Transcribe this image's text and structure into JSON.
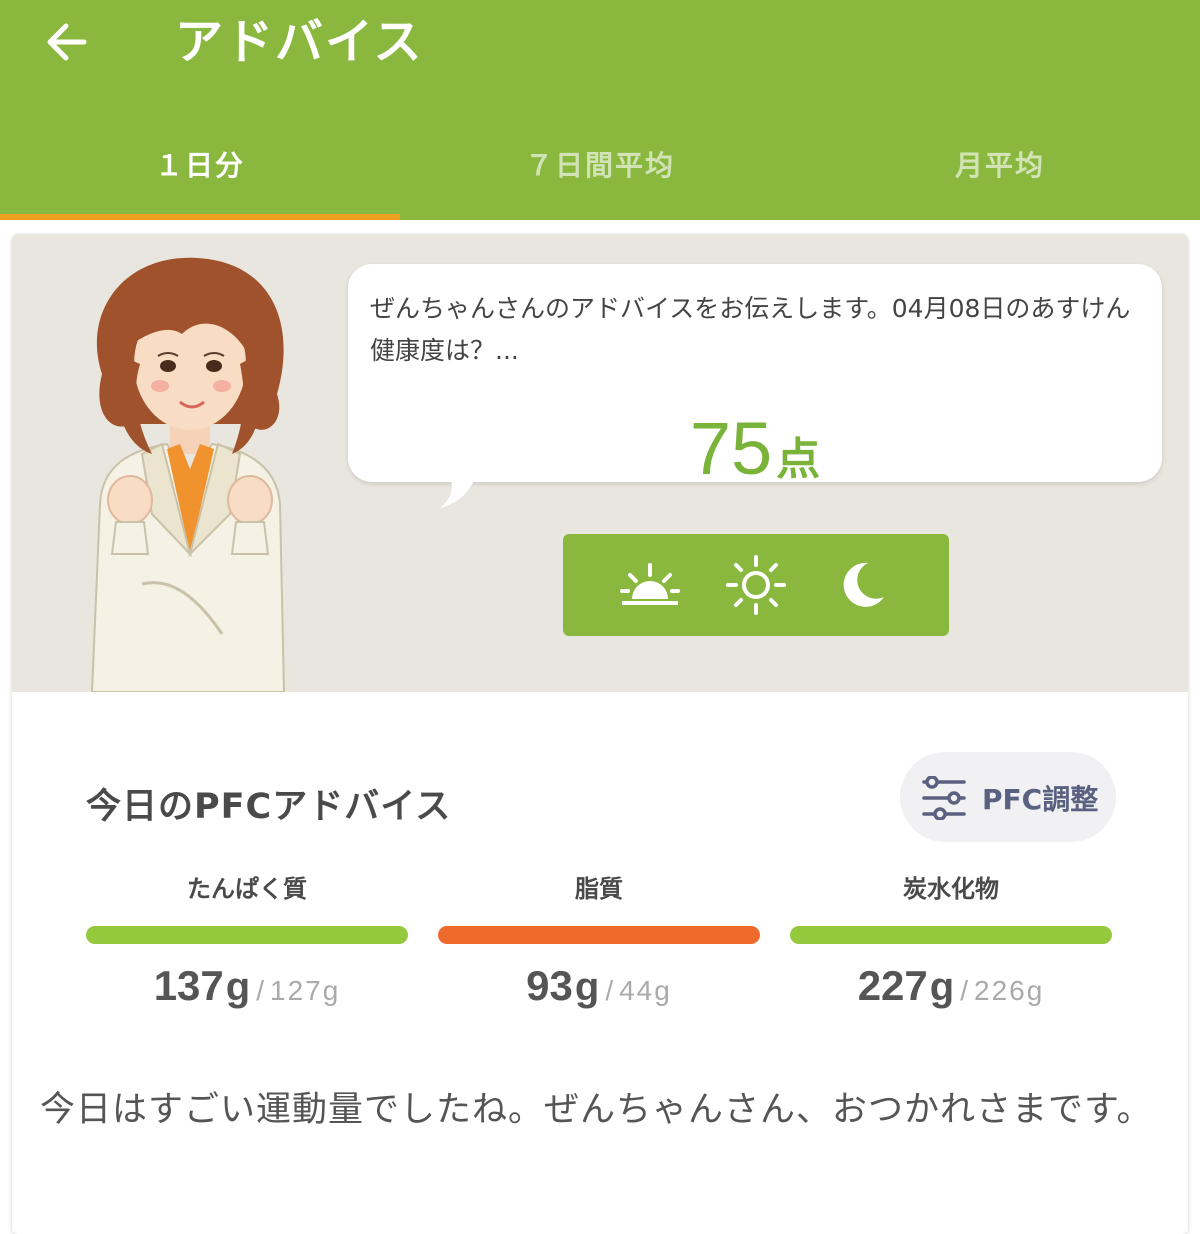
{
  "header": {
    "title": "アドバイス",
    "back_icon": "arrow-left-icon"
  },
  "tabs": [
    {
      "label": "１日分",
      "active": true
    },
    {
      "label": "７日間平均",
      "active": false
    },
    {
      "label": "月平均",
      "active": false
    }
  ],
  "advice": {
    "intro": "ぜんちゃんさんのアドバイスをお伝えします。04月08日のあすけん健康度は？...",
    "score": "75",
    "score_unit": "点"
  },
  "time_of_day": [
    {
      "icon": "sunrise-icon"
    },
    {
      "icon": "sun-icon"
    },
    {
      "icon": "moon-icon"
    }
  ],
  "pfc": {
    "title": "今日のPFCアドバイス",
    "adjust_label": "PFC調整",
    "adjust_icon": "sliders-icon",
    "nutrients": [
      {
        "name": "たんぱく質",
        "value": "137",
        "unit": "g",
        "separator": "/",
        "target": "127g",
        "status_color": "#94c93d"
      },
      {
        "name": "脂質",
        "value": "93",
        "unit": "g",
        "separator": "/",
        "target": "44g",
        "status_color": "#ee6a2c"
      },
      {
        "name": "炭水化物",
        "value": "227",
        "unit": "g",
        "separator": "/",
        "target": "226g",
        "status_color": "#94c93d"
      }
    ]
  },
  "message": "今日はすごい運動量でしたね。ぜんちゃんさん、おつかれさまです。",
  "colors": {
    "brand": "#8ab83f",
    "tab_indicator": "#f0a020",
    "score": "#7ab33a",
    "over": "#ee6a2c",
    "ok": "#94c93d"
  }
}
